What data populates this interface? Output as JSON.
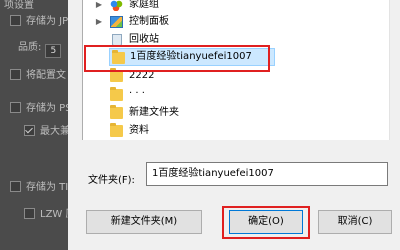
{
  "background_panel": {
    "section_label": "项设置",
    "rows": [
      {
        "label": "存储为 JPE",
        "checked": false
      },
      {
        "label": "品质:",
        "value": "5"
      },
      {
        "label": "将配置文",
        "checked": false
      },
      {
        "label": "存储为 PSD",
        "checked": false
      },
      {
        "label": "最大兼容",
        "checked": true
      },
      {
        "label": "存储为 TIF",
        "checked": false
      },
      {
        "label": "LZW 压",
        "checked": false
      }
    ]
  },
  "tree": {
    "items": [
      {
        "label": "家庭组",
        "icon": "homegroup-icon",
        "expander": "right"
      },
      {
        "label": "控制面板",
        "icon": "control-panel-icon",
        "expander": "right"
      },
      {
        "label": "回收站",
        "icon": "recycle-bin-icon",
        "expander": ""
      },
      {
        "label": "1百度经验tianyuefei1007",
        "icon": "folder-icon",
        "expander": "",
        "selected": true
      },
      {
        "label": "2222",
        "icon": "folder-icon",
        "expander": ""
      },
      {
        "label": ". . .",
        "icon": "folder-icon",
        "expander": ""
      },
      {
        "label": "新建文件夹",
        "icon": "folder-icon",
        "expander": ""
      },
      {
        "label": "资料",
        "icon": "folder-icon",
        "expander": ""
      }
    ]
  },
  "folder_field": {
    "label": "文件夹(F):",
    "value": "1百度经验tianyuefei1007"
  },
  "buttons": {
    "new_folder": "新建文件夹(M)",
    "ok": "确定(O)",
    "cancel": "取消(C)"
  },
  "colors": {
    "highlight_red": "#e02020",
    "selection": "#cce8ff",
    "folder": "#f5c94a"
  }
}
